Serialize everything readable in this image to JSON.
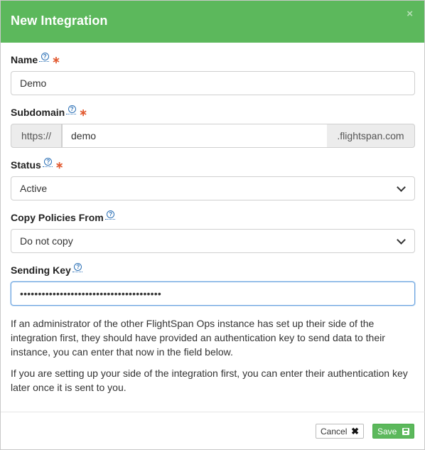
{
  "modal": {
    "title": "New Integration",
    "close_symbol": "×",
    "header_color": "#5cb85c"
  },
  "fields": {
    "name": {
      "label": "Name",
      "value": "Demo",
      "required": true
    },
    "subdomain": {
      "label": "Subdomain",
      "prefix": "https://",
      "value": "demo",
      "suffix": ".flightspan.com",
      "required": true
    },
    "status": {
      "label": "Status",
      "selected": "Active",
      "required": true
    },
    "copy_policies": {
      "label": "Copy Policies From",
      "selected": "Do not copy",
      "required": false
    },
    "sending_key": {
      "label": "Sending Key",
      "masked_value": "•••••••••••••••••••••••••••••••••••••••",
      "required": false
    }
  },
  "help_glyph": "?",
  "required_glyph": "∗",
  "info": {
    "paragraph1": "If an administrator of the other FlightSpan Ops instance has set up their side of the integration first, they should have provided an authentication key to send data to their instance, you can enter that now in the field below.",
    "paragraph2": "If you are setting up your side of the integration first, you can enter their authentication key later once it is sent to you."
  },
  "footer": {
    "cancel_label": "Cancel",
    "cancel_icon": "✖",
    "save_label": "Save"
  },
  "icons": {
    "close": "close-icon",
    "help": "help-icon",
    "cancel": "x-icon",
    "save": "floppy-disk-icon"
  }
}
